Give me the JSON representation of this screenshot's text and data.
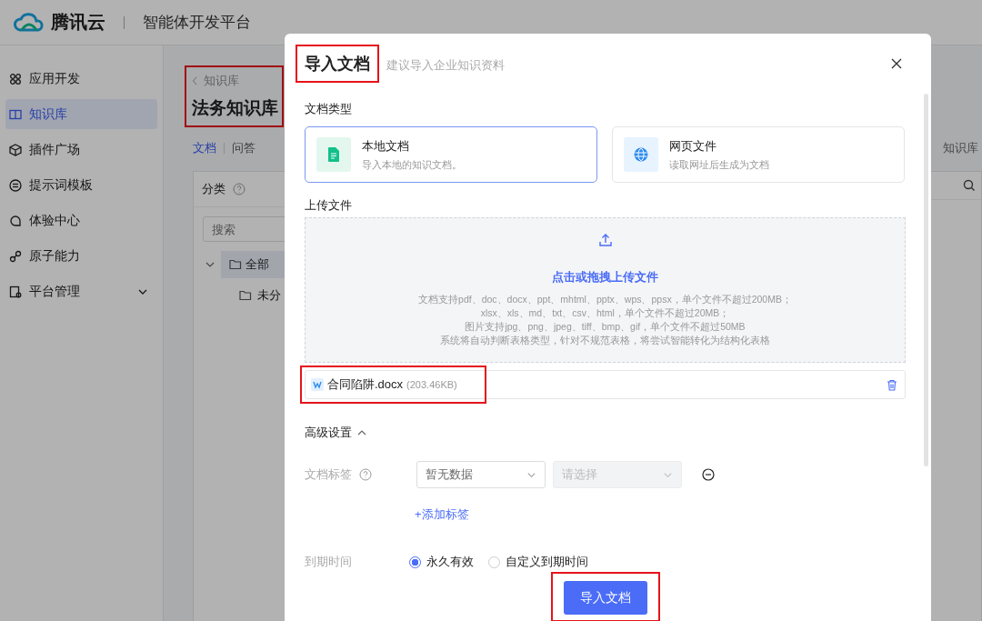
{
  "header": {
    "brand": "腾讯云",
    "product": "智能体开发平台"
  },
  "sidebar": {
    "items": [
      {
        "label": "应用开发",
        "selected": false
      },
      {
        "label": "知识库",
        "selected": true
      },
      {
        "label": "插件广场",
        "selected": false
      },
      {
        "label": "提示词模板",
        "selected": false
      },
      {
        "label": "体验中心",
        "selected": false
      },
      {
        "label": "原子能力",
        "selected": false
      },
      {
        "label": "平台管理",
        "selected": false,
        "expanded": false
      }
    ]
  },
  "page": {
    "back_link": "知识库",
    "title": "法务知识库",
    "highlighted": true,
    "tabs": [
      {
        "label": "文档",
        "selected": true
      },
      {
        "label": "问答",
        "selected": false
      }
    ],
    "right_text": "知识库",
    "category_panel": {
      "title": "分类",
      "search_placeholder": "搜索",
      "tree": [
        {
          "label": "全部",
          "expanded": true,
          "selected": true,
          "children": [
            {
              "label": "未分",
              "selected": false
            }
          ]
        }
      ]
    }
  },
  "modal": {
    "title": "导入文档",
    "subtitle": "建议导入企业知识资料",
    "highlighted": true,
    "doc_type_label": "文档类型",
    "doc_types": [
      {
        "title": "本地文档",
        "desc": "导入本地的知识文档。",
        "selected": true
      },
      {
        "title": "网页文件",
        "desc": "读取网址后生成为文档",
        "selected": false
      }
    ],
    "upload_label": "上传文件",
    "upload": {
      "prompt": "点击或拖拽上传文件",
      "hints": [
        "文档支持pdf、doc、docx、ppt、mhtml、pptx、wps、ppsx，单个文件不超过200MB；",
        "xlsx、xls、md、txt、csv、html，单个文件不超过20MB；",
        "图片支持jpg、png、jpeg、tiff、bmp、gif，单个文件不超过50MB",
        "系统将自动判断表格类型，针对不规范表格，将尝试智能转化为结构化表格"
      ]
    },
    "files": [
      {
        "name": "合同陷阱.docx",
        "size": "(203.46KB)",
        "highlighted": true
      }
    ],
    "advanced": {
      "label": "高级设置",
      "expanded": true,
      "tag_label": "文档标签",
      "tag_key": {
        "value": "暂无数据",
        "disabled": false
      },
      "tag_value": {
        "placeholder": "请选择",
        "disabled": true
      },
      "add_tag": "+添加标签",
      "expiry_label": "到期时间",
      "expiry_options": [
        {
          "label": "永久有效",
          "selected": true
        },
        {
          "label": "自定义到期时间",
          "selected": false
        }
      ]
    },
    "submit": {
      "label": "导入文档",
      "highlighted": true
    }
  }
}
